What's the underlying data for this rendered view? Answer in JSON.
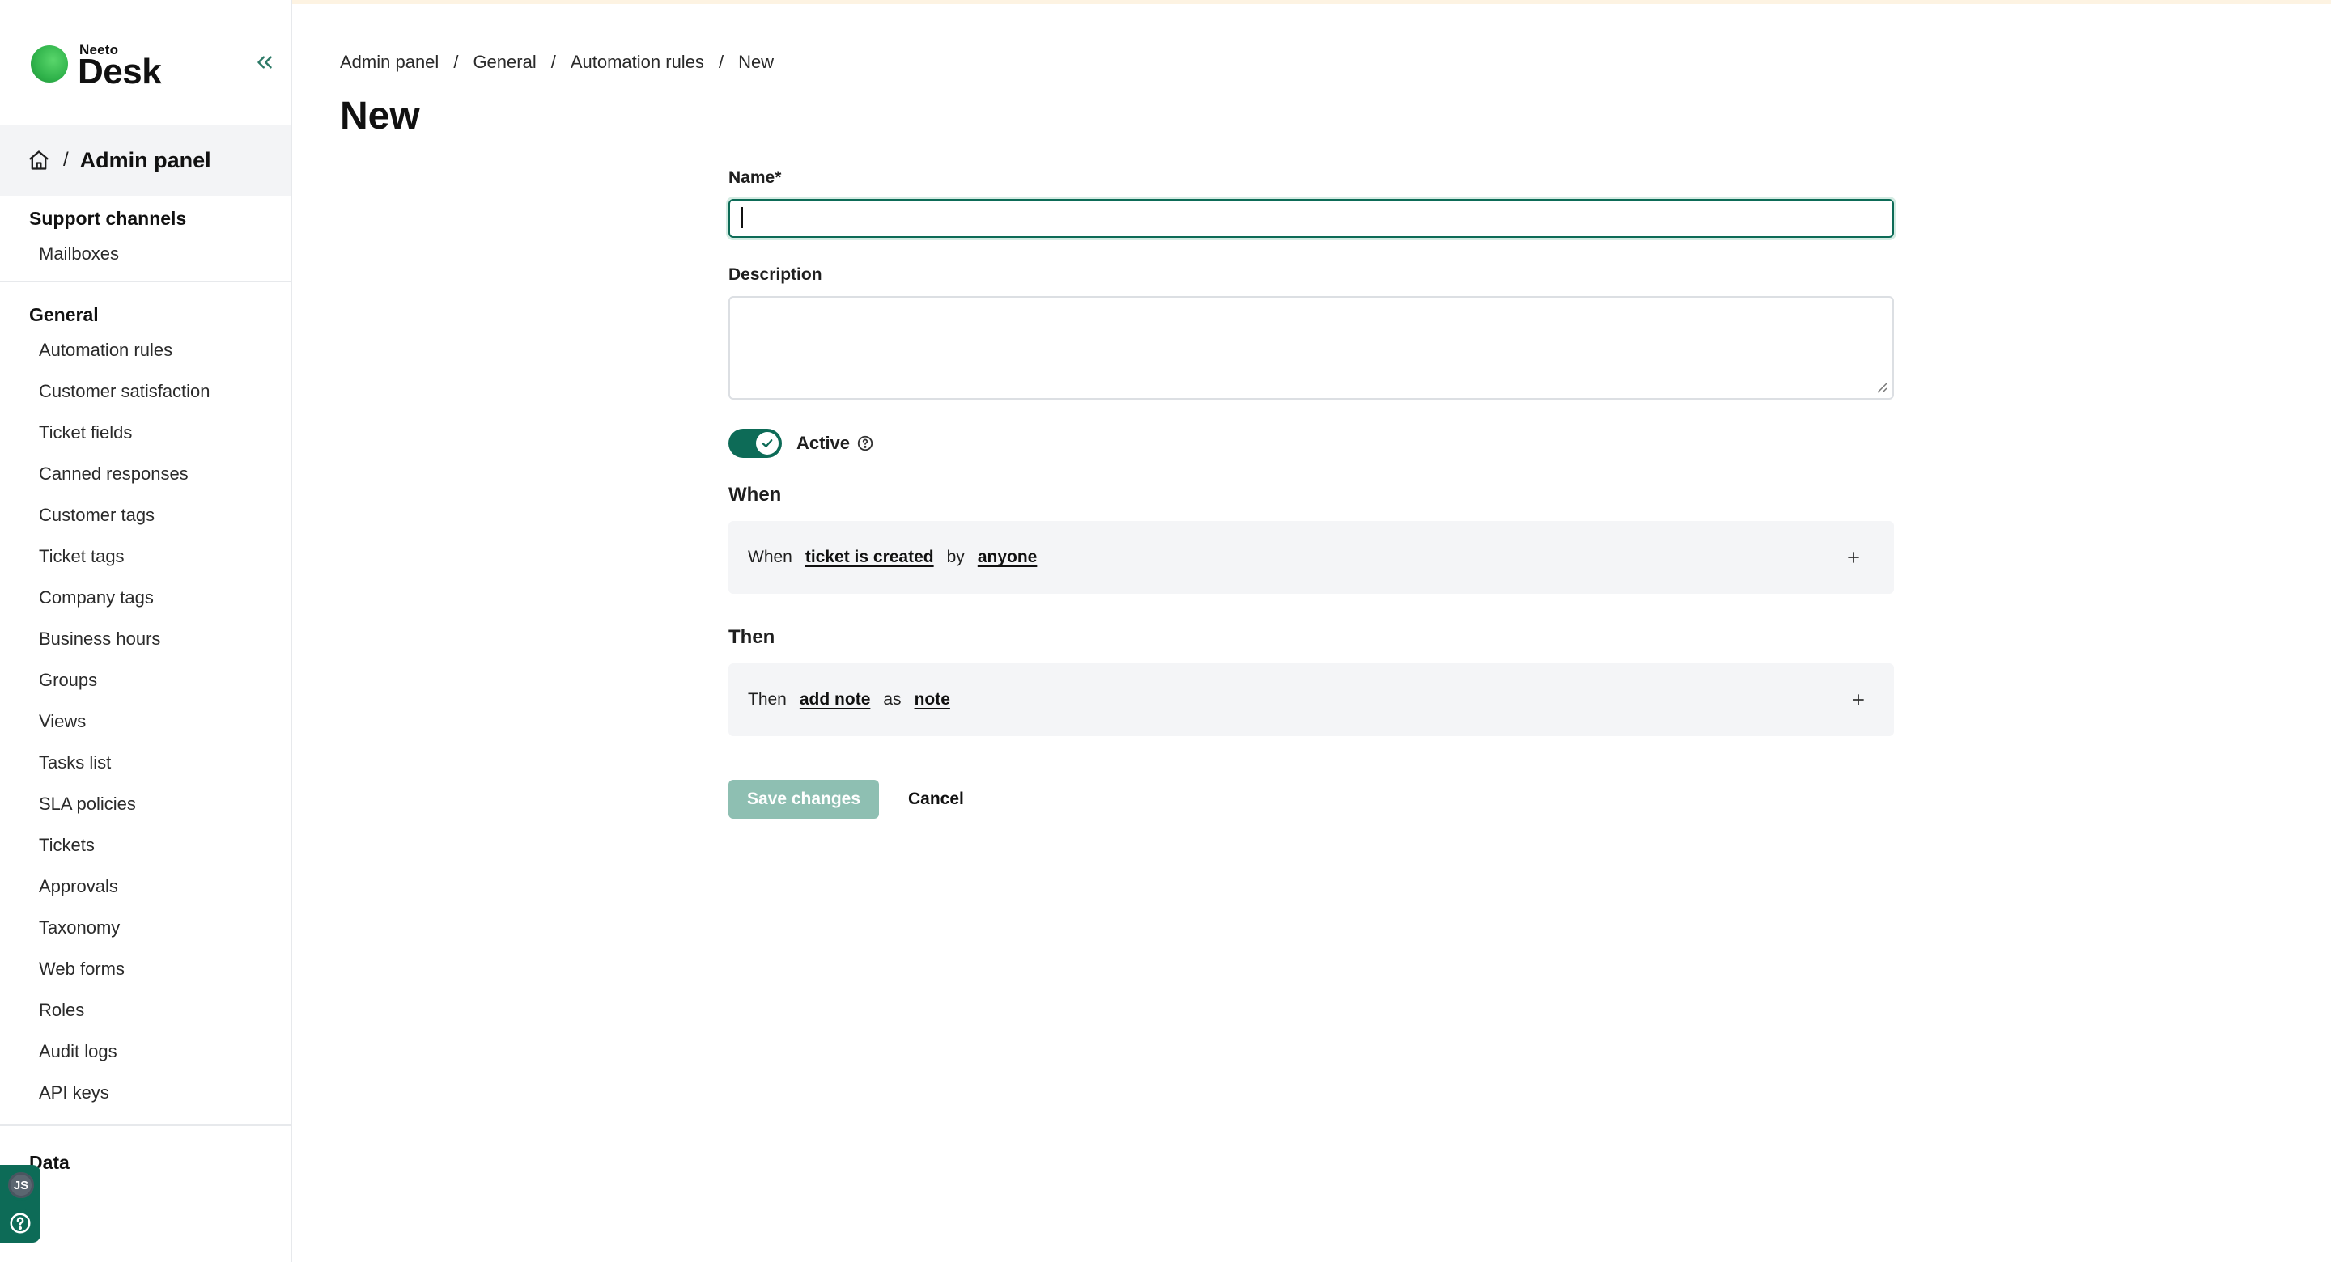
{
  "brand": {
    "small": "Neeto",
    "big": "Desk",
    "accent": "#0d6b57"
  },
  "sidebar": {
    "header_title": "Admin panel",
    "header_sep": "/",
    "sections": [
      {
        "title": "Support channels",
        "items": [
          "Mailboxes"
        ]
      },
      {
        "title": "General",
        "items": [
          "Automation rules",
          "Customer satisfaction",
          "Ticket fields",
          "Canned responses",
          "Customer tags",
          "Ticket tags",
          "Company tags",
          "Business hours",
          "Groups",
          "Views",
          "Tasks list",
          "SLA policies",
          "Tickets",
          "Approvals",
          "Taxonomy",
          "Web forms",
          "Roles",
          "Audit logs",
          "API keys"
        ]
      },
      {
        "title": "Data",
        "items": []
      }
    ],
    "avatar_initials": "JS"
  },
  "breadcrumb": {
    "items": [
      "Admin panel",
      "General",
      "Automation rules",
      "New"
    ],
    "sep": "/"
  },
  "page": {
    "title": "New"
  },
  "form": {
    "name_label": "Name*",
    "name_value": "",
    "description_label": "Description",
    "description_value": "",
    "active_label": "Active",
    "active": true,
    "when": {
      "title": "When",
      "parts": {
        "w1": "When",
        "l1": "ticket is created",
        "w2": "by",
        "l2": "anyone"
      }
    },
    "then": {
      "title": "Then",
      "parts": {
        "w1": "Then",
        "l1": "add note",
        "w2": "as",
        "l2": "note"
      }
    },
    "save_label": "Save changes",
    "cancel_label": "Cancel"
  }
}
